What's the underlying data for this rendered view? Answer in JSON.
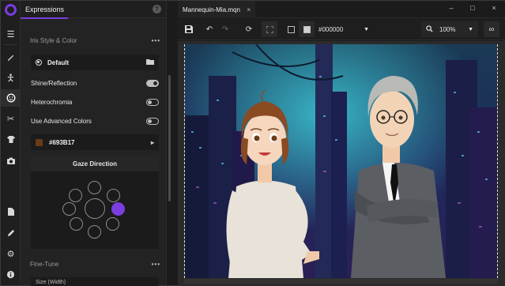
{
  "panel": {
    "tab_label": "Expressions",
    "help_icon_label": "?",
    "iris_section_title": "Iris Style & Color",
    "iris_style_value": "Default",
    "shine_label": "Shine/Reflection",
    "shine_on": true,
    "heterochromia_label": "Heterochromia",
    "heterochromia_on": false,
    "advanced_colors_label": "Use Advanced Colors",
    "advanced_colors_on": false,
    "iris_color_value": "#693B17",
    "iris_color_swatch": "#693B17",
    "gaze_title": "Gaze Direction",
    "fine_tune_title": "Fine-Tune",
    "fine_tune_field": "Size (Width)"
  },
  "document": {
    "tab_title": "Mannequin-Mia.mqn",
    "tab_close": "×",
    "background_color": "#000000",
    "zoom": "100%"
  },
  "window": {
    "min": "–",
    "max": "□",
    "close": "×"
  },
  "accent": "#7a3de0"
}
